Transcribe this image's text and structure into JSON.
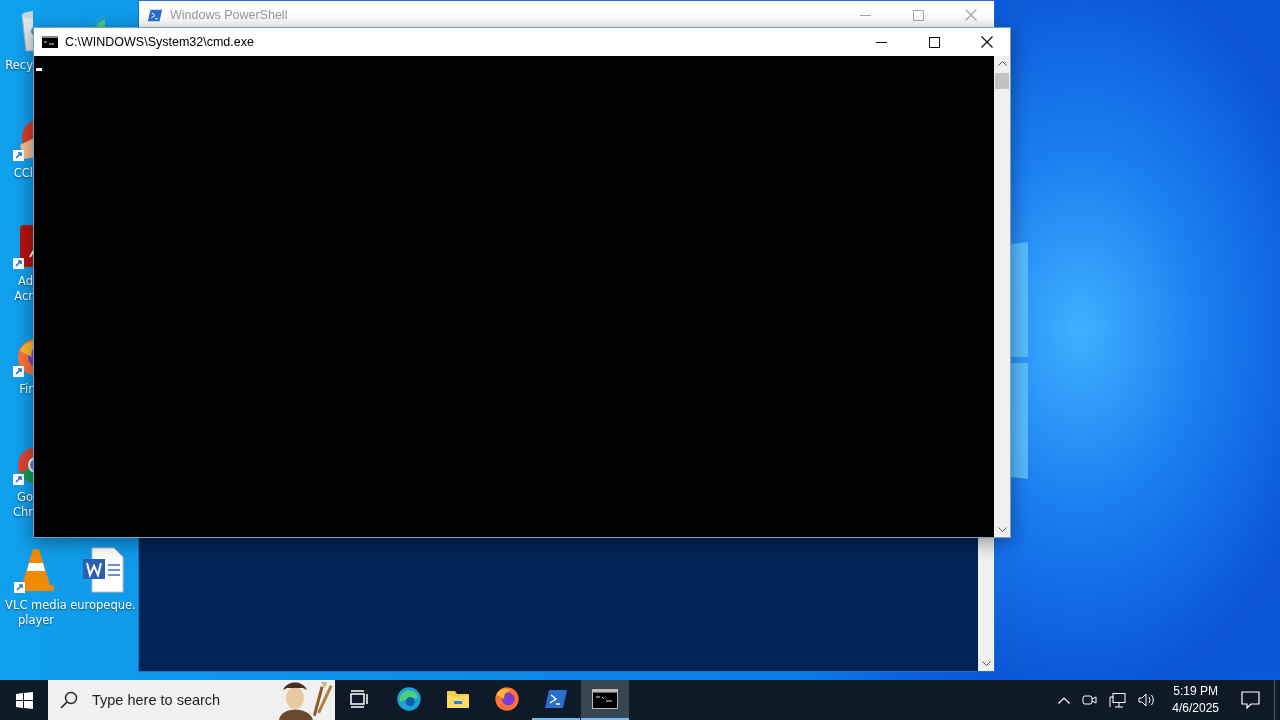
{
  "desktop": {
    "icons": [
      {
        "kind": "recycle",
        "lines": [
          "Recy"
        ],
        "shortcut": false
      },
      {
        "kind": "edge",
        "shortcut": false
      },
      {
        "kind": "ccleaner",
        "lines": [
          "CCl"
        ],
        "shortcut": true
      },
      {
        "kind": "acrobat",
        "lines": [
          "Ad",
          "Acr"
        ],
        "shortcut": true
      },
      {
        "kind": "firefox",
        "lines": [
          "Fir"
        ],
        "shortcut": true
      },
      {
        "kind": "chrome",
        "lines": [
          "Go",
          "Chr"
        ],
        "shortcut": true
      },
      {
        "kind": "vlc",
        "lines": [
          "VLC media",
          "player"
        ],
        "shortcut": true
      },
      {
        "kind": "word",
        "lines": [
          "europeque."
        ],
        "shortcut": false
      }
    ]
  },
  "windows": [
    {
      "kind": "powershell",
      "title": "Windows PowerShell",
      "active": false
    },
    {
      "kind": "cmd",
      "title": "C:\\WINDOWS\\System32\\cmd.exe",
      "active": true
    }
  ],
  "taskbar": {
    "search": {
      "placeholder": "Type here to search"
    },
    "apps": [
      {
        "kind": "taskview",
        "open": false,
        "selected": false
      },
      {
        "kind": "edge",
        "open": false,
        "selected": false
      },
      {
        "kind": "explorer",
        "open": false,
        "selected": false
      },
      {
        "kind": "firefox",
        "open": false,
        "selected": false
      },
      {
        "kind": "powershell",
        "open": true,
        "selected": false
      },
      {
        "kind": "cmd",
        "open": true,
        "selected": true
      }
    ],
    "clock": {
      "time": "5:19 PM",
      "date": "4/6/2025"
    }
  }
}
